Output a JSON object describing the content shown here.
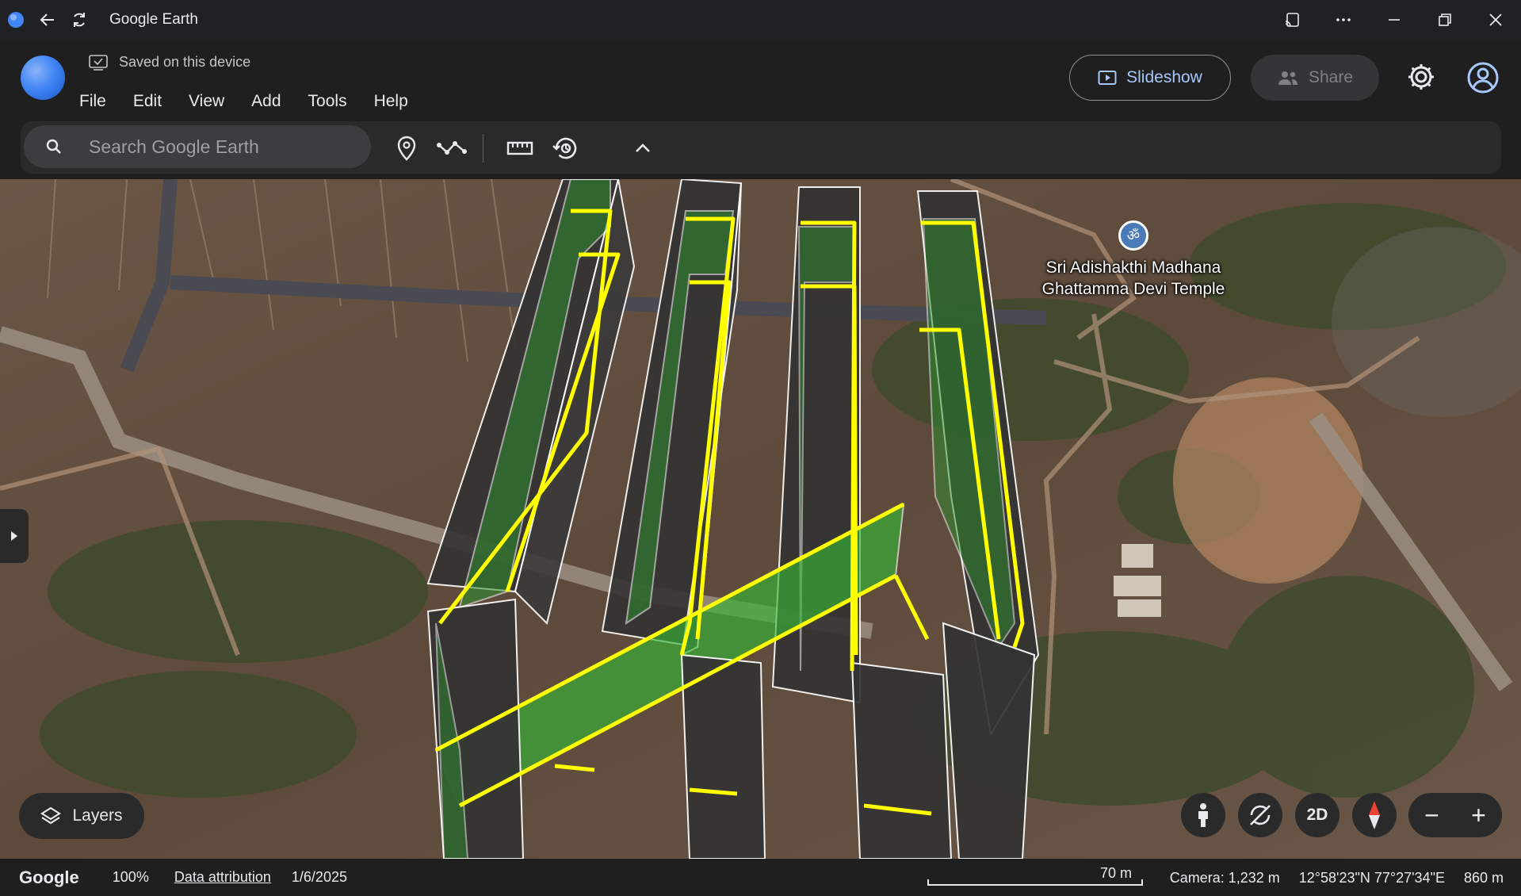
{
  "window": {
    "title": "Google Earth"
  },
  "app": {
    "saved_status": "Saved on this device",
    "menu": [
      "File",
      "Edit",
      "View",
      "Add",
      "Tools",
      "Help"
    ],
    "slideshow_label": "Slideshow",
    "share_label": "Share"
  },
  "search": {
    "placeholder": "Search Google Earth"
  },
  "map": {
    "poi_label_line1": "Sri Adishakthi Madhana",
    "poi_label_line2": "Ghattamma Devi Temple",
    "poi_icon": "om-icon",
    "layers_label": "Layers",
    "view_mode_label": "2D",
    "zoom_out": "−",
    "zoom_in": "+"
  },
  "status": {
    "brand": "Google",
    "zoom": "100%",
    "attribution": "Data attribution",
    "date": "1/6/2025",
    "scale": "70 m",
    "camera": "Camera: 1,232 m",
    "coordinates": "12°58'23\"N 77°27'34\"E",
    "elevation": "860 m"
  },
  "colors": {
    "accent": "#a8c7fa",
    "polygon_outline": "#ffff00",
    "polygon_fill": "#2ea82e",
    "extrude_wall": "#333333"
  }
}
